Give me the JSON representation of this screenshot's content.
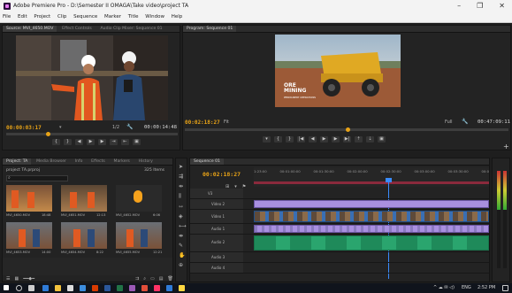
{
  "app": {
    "title": "Adobe Premiere Pro - D:\\Semester II OMAGA\\Take video\\project TA",
    "window_buttons": [
      "–",
      "❐",
      "✕"
    ]
  },
  "menu": [
    "File",
    "Edit",
    "Project",
    "Clip",
    "Sequence",
    "Marker",
    "Title",
    "Window",
    "Help"
  ],
  "source_monitor": {
    "tabs": [
      "Source: MVI_4650.MOV",
      "Effect Controls",
      "Audio Clip Mixer: Sequence 01"
    ],
    "timecode_left": "00:00:03:17",
    "fit": "1/2",
    "timecode_right": "00:00:14:48"
  },
  "program_monitor": {
    "tabs": [
      "Program: Sequence 01"
    ],
    "timecode_left": "00:02:18:27",
    "fit_left": "Fit",
    "fit_right": "Full",
    "timecode_right": "00:47:09:11",
    "overlay_title": "ORE MINING",
    "overlay_subtitle": "PERMANENT OPERATIONS"
  },
  "project_panel": {
    "tabs": [
      "Project: TA",
      "Media Browser",
      "Info",
      "Effects",
      "Markers",
      "History"
    ],
    "name": "project TA.prproj",
    "items_count": "325 Items",
    "thumbs": [
      {
        "name": "MVI_4650.MOV",
        "dur": "18:48"
      },
      {
        "name": "MVI_4651.MOV",
        "dur": "12:13"
      },
      {
        "name": "MVI_4652.MOV",
        "dur": "6:06"
      },
      {
        "name": "MVI_4653.MOV",
        "dur": "14:00"
      },
      {
        "name": "MVI_4654.MOV",
        "dur": "8:22"
      },
      {
        "name": "MVI_4655.MOV",
        "dur": "12:21"
      }
    ]
  },
  "timeline": {
    "tab": "Sequence 01",
    "timecode": "00:02:18:27",
    "ruler": [
      "1:23:00",
      "00:01:00:00",
      "00:01:30:00",
      "00:02:00:00",
      "00:02:30:00",
      "00:03:00:00",
      "00:03:30:00",
      "00:0"
    ],
    "tracks": [
      {
        "name": "V3",
        "label": ""
      },
      {
        "name": "V2",
        "label": "Video 2"
      },
      {
        "name": "V1",
        "label": "Video 1"
      },
      {
        "name": "A1",
        "label": "Audio 1"
      },
      {
        "name": "A2",
        "label": "Audio 2"
      },
      {
        "name": "A3",
        "label": "Audio 3"
      },
      {
        "name": "A4",
        "label": "Audio 4"
      }
    ]
  },
  "taskbar": {
    "clock": "2:52 PM",
    "lang": "ENG"
  },
  "colors": {
    "timecode": "#e8a317",
    "accent": "#3a8cff",
    "video_clip": "#a98fe0",
    "audio_clip": "#2aa56e"
  }
}
